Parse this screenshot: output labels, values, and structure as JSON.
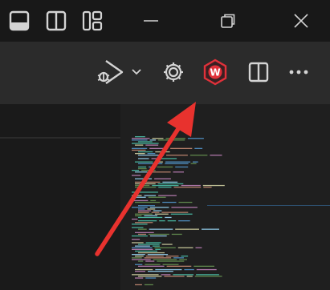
{
  "titlebar": {
    "layout_icons": [
      "panel-bottom-icon",
      "split-vertical-icon",
      "customize-layout-icon"
    ],
    "window_controls": [
      "minimize-icon",
      "restore-icon",
      "close-icon"
    ]
  },
  "actionbar": {
    "buttons": [
      "run-debug-icon",
      "dropdown-chevron-icon",
      "settings-gear-icon",
      "extension-w-icon",
      "split-editor-icon",
      "more-actions-icon"
    ],
    "extension_badge_letter": "W"
  },
  "colors": {
    "titlebar_bg": "#181818",
    "actionbar_bg": "#2b2b2b",
    "editor_bg": "#1e1e1e",
    "icon": "#d4d4d4",
    "extension_red": "#e0313a",
    "arrow_red": "#e8322e"
  }
}
